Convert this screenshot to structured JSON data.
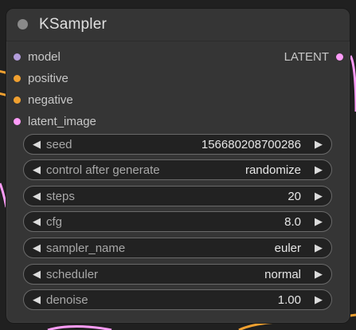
{
  "node": {
    "title": "KSampler",
    "colors": {
      "background": "#353535",
      "canvas": "#202020",
      "widget_background": "#222222",
      "widget_border": "#6a6a6a"
    }
  },
  "inputs": [
    {
      "label": "model",
      "color": "#b39ddb"
    },
    {
      "label": "positive",
      "color": "#f0a030"
    },
    {
      "label": "negative",
      "color": "#f0a030"
    },
    {
      "label": "latent_image",
      "color": "#ff9cf9"
    }
  ],
  "outputs": [
    {
      "label": "LATENT",
      "color": "#ff9cf9"
    }
  ],
  "widgets": [
    {
      "label": "seed",
      "value": "156680208700286"
    },
    {
      "label": "control after generate",
      "value": "randomize"
    },
    {
      "label": "steps",
      "value": "20"
    },
    {
      "label": "cfg",
      "value": "8.0"
    },
    {
      "label": "sampler_name",
      "value": "euler"
    },
    {
      "label": "scheduler",
      "value": "normal"
    },
    {
      "label": "denoise",
      "value": "1.00"
    }
  ],
  "icons": {
    "decrement": "◀",
    "increment": "▶",
    "collapse": "collapse-dot-icon"
  },
  "wire_colors": {
    "conditioning": "#f0a030",
    "latent": "#ff9cf9"
  }
}
